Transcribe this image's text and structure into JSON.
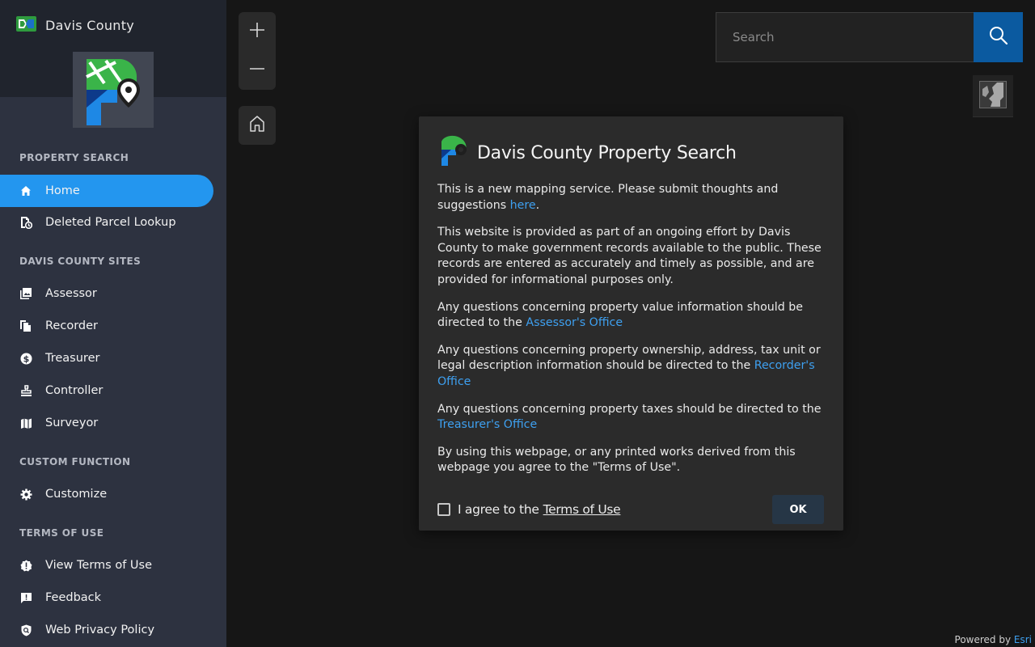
{
  "app": {
    "title": "Davis County"
  },
  "sidebar": {
    "sections": [
      {
        "title": "PROPERTY SEARCH",
        "items": [
          {
            "label": "Home",
            "icon": "home-icon",
            "active": true
          },
          {
            "label": "Deleted Parcel Lookup",
            "icon": "deleted-parcel-icon"
          }
        ]
      },
      {
        "title": "DAVIS COUNTY SITES",
        "items": [
          {
            "label": "Assessor",
            "icon": "image-gallery-icon"
          },
          {
            "label": "Recorder",
            "icon": "documents-icon"
          },
          {
            "label": "Treasurer",
            "icon": "dollar-icon"
          },
          {
            "label": "Controller",
            "icon": "stamp-icon"
          },
          {
            "label": "Surveyor",
            "icon": "map-icon"
          }
        ]
      },
      {
        "title": "CUSTOM FUNCTION",
        "items": [
          {
            "label": "Customize",
            "icon": "gear-icon"
          }
        ]
      },
      {
        "title": "TERMS OF USE",
        "items": [
          {
            "label": "View Terms of Use",
            "icon": "alert-badge-icon"
          },
          {
            "label": "Feedback",
            "icon": "feedback-icon"
          },
          {
            "label": "Web Privacy Policy",
            "icon": "privacy-shield-icon"
          }
        ]
      }
    ]
  },
  "search": {
    "placeholder": "Search"
  },
  "dialog": {
    "title": "Davis County Property Search",
    "p1_text": "This is a new mapping service. Please submit thoughts and suggestions ",
    "p1_link": "here",
    "p1_end": ".",
    "p2_text": "This website is provided as part of an ongoing effort by Davis County to make government records available to the public. These records are entered as accurately and timely as possible, and are provided for informational purposes only.",
    "p3_text": "Any questions concerning property value information should be directed to the ",
    "p3_link": "Assessor's Office",
    "p4_text": "Any questions concerning property ownership, address, tax unit or legal description information should be directed to the ",
    "p4_link": "Recorder's Office",
    "p5_text": "Any questions concerning property taxes should be directed to the ",
    "p5_link": "Treasurer's Office",
    "p6_text": "By using this webpage, or any printed works derived from this webpage you agree to the \"Terms of Use\".",
    "agree_text": "I agree to the",
    "terms_link": "Terms of Use",
    "ok_label": "OK"
  },
  "attribution": {
    "text": "Powered by ",
    "link": "Esri"
  },
  "colors": {
    "accent": "#2396ef",
    "link": "#3ea0f0",
    "sidebar_bg": "#2d3240",
    "search_button": "#0b5aa0"
  }
}
